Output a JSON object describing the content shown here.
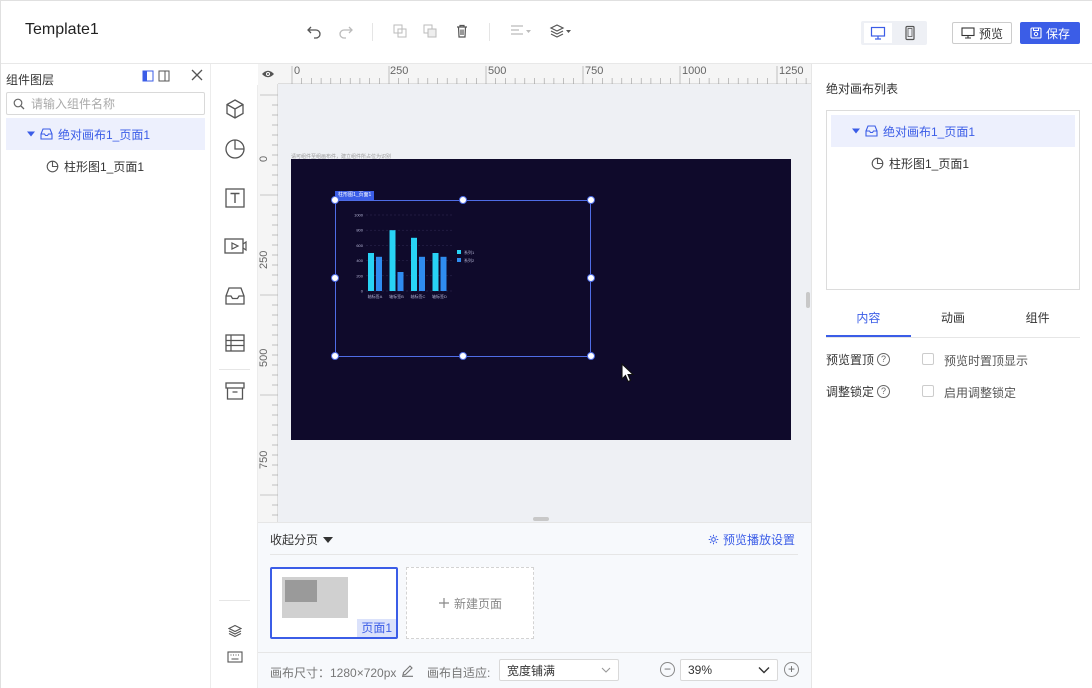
{
  "header": {
    "title": "Template1",
    "preview_label": "预览",
    "save_label": "保存"
  },
  "left_panel": {
    "title": "组件图层",
    "search_placeholder": "请输入组件名称",
    "tree": [
      {
        "label": "绝对画布1_页面1",
        "selected": true
      },
      {
        "label": "柱形图1_页面1",
        "selected": false
      }
    ]
  },
  "canvas": {
    "ruler_h": [
      "0",
      "250",
      "500",
      "750",
      "1000",
      "1250"
    ],
    "ruler_v": [
      "0",
      "250",
      "500",
      "750"
    ],
    "hint": "请可组件至组画布件，建立组件所占位为识别",
    "selected_tag": "柱形图1_页面1"
  },
  "chart_data": {
    "type": "bar",
    "categories": [
      "轴标签A",
      "轴标签B",
      "轴标签C",
      "轴标签D"
    ],
    "series": [
      {
        "name": "系列1",
        "values": [
          500,
          800,
          700,
          500
        ],
        "color": "#28d3f5"
      },
      {
        "name": "系列2",
        "values": [
          450,
          250,
          450,
          450
        ],
        "color": "#2f8cf0"
      }
    ],
    "yticks": [
      "0",
      "200",
      "400",
      "600",
      "800",
      "1000"
    ],
    "ylim": [
      0,
      1000
    ],
    "legend": "right"
  },
  "pages_panel": {
    "collapse_label": "收起分页",
    "settings_label": "预览播放设置",
    "page_label": "页面1",
    "new_page_label": "新建页面"
  },
  "status_bar": {
    "canvas_size_label": "画布尺寸：1280×720px",
    "fit_label": "画布自适应:",
    "fit_value": "宽度铺满",
    "zoom_value": "39%"
  },
  "right_panel": {
    "title": "绝对画布列表",
    "tree": [
      {
        "label": "绝对画布1_页面1"
      },
      {
        "label": "柱形图1_页面1"
      }
    ],
    "tabs": [
      "内容",
      "动画",
      "组件"
    ],
    "props": [
      {
        "label": "预览置顶",
        "checkbox_label": "预览时置顶显示"
      },
      {
        "label": "调整锁定",
        "checkbox_label": "启用调整锁定"
      }
    ]
  },
  "colors": {
    "accent": "#3b5de7",
    "stage_bg": "#0f0a2b"
  }
}
